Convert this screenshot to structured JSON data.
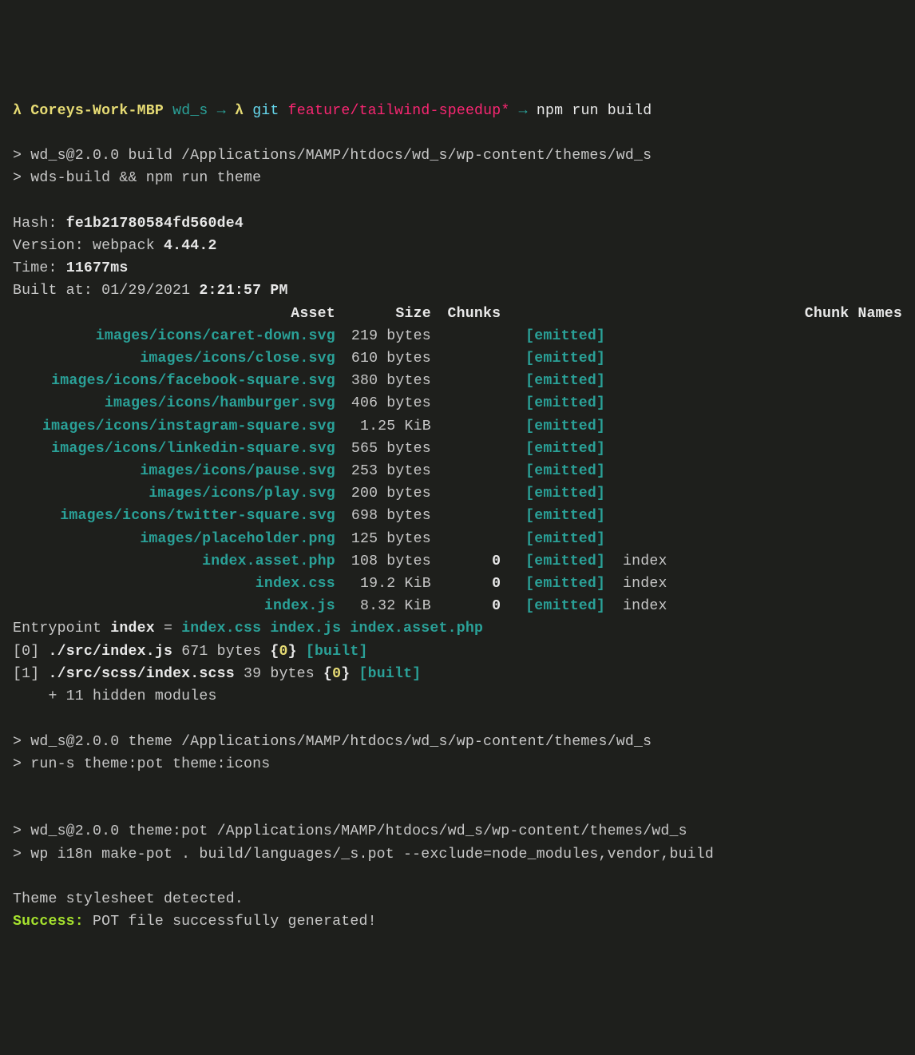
{
  "prompt": {
    "lambda1": "λ",
    "host": "Coreys-Work-MBP",
    "dir": "wd_s",
    "arrow1": "→",
    "lambda2": "λ",
    "git": "git",
    "branch": "feature/tailwind-speedup*",
    "arrow2": "→",
    "command": "npm run build"
  },
  "script_echo1": "> wd_s@2.0.0 build /Applications/MAMP/htdocs/wd_s/wp-content/themes/wd_s",
  "script_echo2": "> wds-build && npm run theme",
  "webpack": {
    "hash_label": "Hash:",
    "hash": "fe1b21780584fd560de4",
    "version_label": "Version: webpack",
    "version": "4.44.2",
    "time_label": "Time:",
    "time": "11677ms",
    "built_label": "Built at: 01/29/2021",
    "built_time": "2:21:57 PM",
    "header": {
      "asset": "Asset",
      "size": "Size",
      "chunks": "Chunks",
      "names": "Chunk Names"
    },
    "assets": [
      {
        "asset": "images/icons/caret-down.svg",
        "size": "219 bytes",
        "chunks": "",
        "emitted": "[emitted]",
        "names": ""
      },
      {
        "asset": "images/icons/close.svg",
        "size": "610 bytes",
        "chunks": "",
        "emitted": "[emitted]",
        "names": ""
      },
      {
        "asset": "images/icons/facebook-square.svg",
        "size": "380 bytes",
        "chunks": "",
        "emitted": "[emitted]",
        "names": ""
      },
      {
        "asset": "images/icons/hamburger.svg",
        "size": "406 bytes",
        "chunks": "",
        "emitted": "[emitted]",
        "names": ""
      },
      {
        "asset": "images/icons/instagram-square.svg",
        "size": "1.25 KiB",
        "chunks": "",
        "emitted": "[emitted]",
        "names": ""
      },
      {
        "asset": "images/icons/linkedin-square.svg",
        "size": "565 bytes",
        "chunks": "",
        "emitted": "[emitted]",
        "names": ""
      },
      {
        "asset": "images/icons/pause.svg",
        "size": "253 bytes",
        "chunks": "",
        "emitted": "[emitted]",
        "names": ""
      },
      {
        "asset": "images/icons/play.svg",
        "size": "200 bytes",
        "chunks": "",
        "emitted": "[emitted]",
        "names": ""
      },
      {
        "asset": "images/icons/twitter-square.svg",
        "size": "698 bytes",
        "chunks": "",
        "emitted": "[emitted]",
        "names": ""
      },
      {
        "asset": "images/placeholder.png",
        "size": "125 bytes",
        "chunks": "",
        "emitted": "[emitted]",
        "names": ""
      },
      {
        "asset": "index.asset.php",
        "size": "108 bytes",
        "chunks": "0",
        "emitted": "[emitted]",
        "names": "index"
      },
      {
        "asset": "index.css",
        "size": "19.2 KiB",
        "chunks": "0",
        "emitted": "[emitted]",
        "names": "index"
      },
      {
        "asset": "index.js",
        "size": "8.32 KiB",
        "chunks": "0",
        "emitted": "[emitted]",
        "names": "index"
      }
    ],
    "entry_label": "Entrypoint ",
    "entry_name": "index",
    "entry_eq": " = ",
    "entry_files": "index.css index.js index.asset.php",
    "mod0": {
      "idx": "[0] ",
      "file": "./src/index.js",
      "size": " 671 bytes ",
      "ob": "{",
      "n": "0",
      "cb": "}",
      "built": " [built]"
    },
    "mod1": {
      "idx": "[1] ",
      "file": "./src/scss/index.scss",
      "size": " 39 bytes ",
      "ob": "{",
      "n": "0",
      "cb": "}",
      "built": " [built]"
    },
    "hidden": "    + 11 hidden modules"
  },
  "theme_echo1": "> wd_s@2.0.0 theme /Applications/MAMP/htdocs/wd_s/wp-content/themes/wd_s",
  "theme_echo2": "> run-s theme:pot theme:icons",
  "pot_echo1": "> wd_s@2.0.0 theme:pot /Applications/MAMP/htdocs/wd_s/wp-content/themes/wd_s",
  "pot_echo2": "> wp i18n make-pot . build/languages/_s.pot --exclude=node_modules,vendor,build",
  "detected": "Theme stylesheet detected.",
  "success_label": "Success:",
  "success_msg": " POT file successfully generated!"
}
